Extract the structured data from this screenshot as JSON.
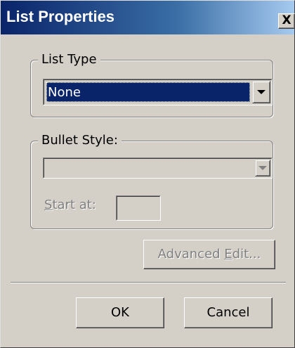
{
  "window": {
    "title": "List Properties",
    "close_label": "X"
  },
  "list_type": {
    "group_label": "List Type",
    "selected_value": "None"
  },
  "bullet_style": {
    "group_label": "Bullet Style:",
    "selected_value": "",
    "start_at_label_prefix": "S",
    "start_at_label_rest": "tart at:",
    "start_at_value": ""
  },
  "buttons": {
    "advanced_edit_prefix": "Advanced ",
    "advanced_edit_underlined": "E",
    "advanced_edit_suffix": "dit...",
    "ok_label": "OK",
    "cancel_label": "Cancel"
  },
  "colors": {
    "face": "#d4d0c8",
    "title_start": "#0a246a",
    "title_end": "#a6caf0",
    "selection": "#0a246a",
    "disabled_text": "#808080"
  }
}
